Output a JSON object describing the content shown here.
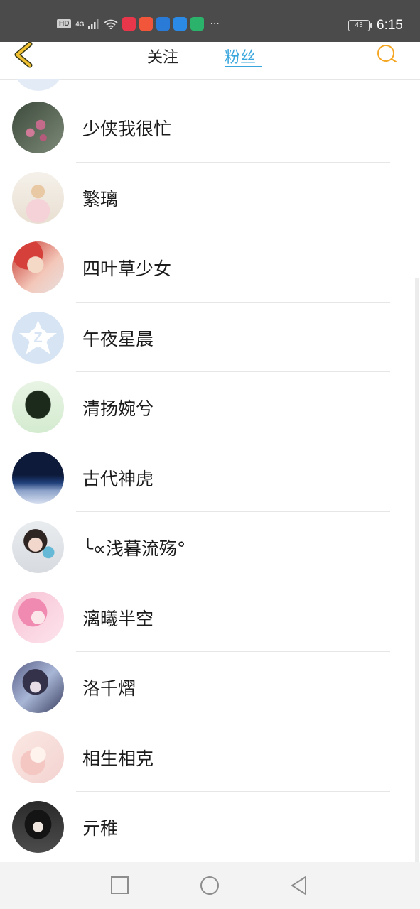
{
  "status_bar": {
    "hd": "HD",
    "network": "4G",
    "battery": "43",
    "time": "6:15",
    "more": "···",
    "app_icons": [
      {
        "name": "tmall-icon",
        "color": "#e8364a"
      },
      {
        "name": "taobao-icon",
        "color": "#f2563a"
      },
      {
        "name": "app-blue-icon",
        "color": "#2a7bd8"
      },
      {
        "name": "qq-browser-icon",
        "color": "#2b8ae6"
      },
      {
        "name": "news-icon",
        "color": "#2bb36b"
      }
    ]
  },
  "header": {
    "tabs": [
      {
        "label": "关注",
        "active": false
      },
      {
        "label": "粉丝",
        "active": true
      }
    ],
    "accent_color": "#3aa6de",
    "back_color": "#f0c030",
    "search_color": "#f5a623"
  },
  "fans": [
    {
      "name": "少侠我很忙",
      "avatar": "peach-blossom"
    },
    {
      "name": "繁璃",
      "avatar": "anime-girl-white"
    },
    {
      "name": "四叶草少女",
      "avatar": "anime-boy-red"
    },
    {
      "name": "午夜星晨",
      "avatar": "default-qzone"
    },
    {
      "name": "清扬婉兮",
      "avatar": "black-hair-back"
    },
    {
      "name": "古代神虎",
      "avatar": "night-city"
    },
    {
      "name": "╰∝浅暮流殇°",
      "avatar": "girl-photo"
    },
    {
      "name": "漓曦半空",
      "avatar": "anime-pink-hair"
    },
    {
      "name": "洛千熠",
      "avatar": "anime-dark"
    },
    {
      "name": "相生相克",
      "avatar": "anime-pastel"
    },
    {
      "name": "亓稚",
      "avatar": "anime-dark-hair"
    }
  ]
}
